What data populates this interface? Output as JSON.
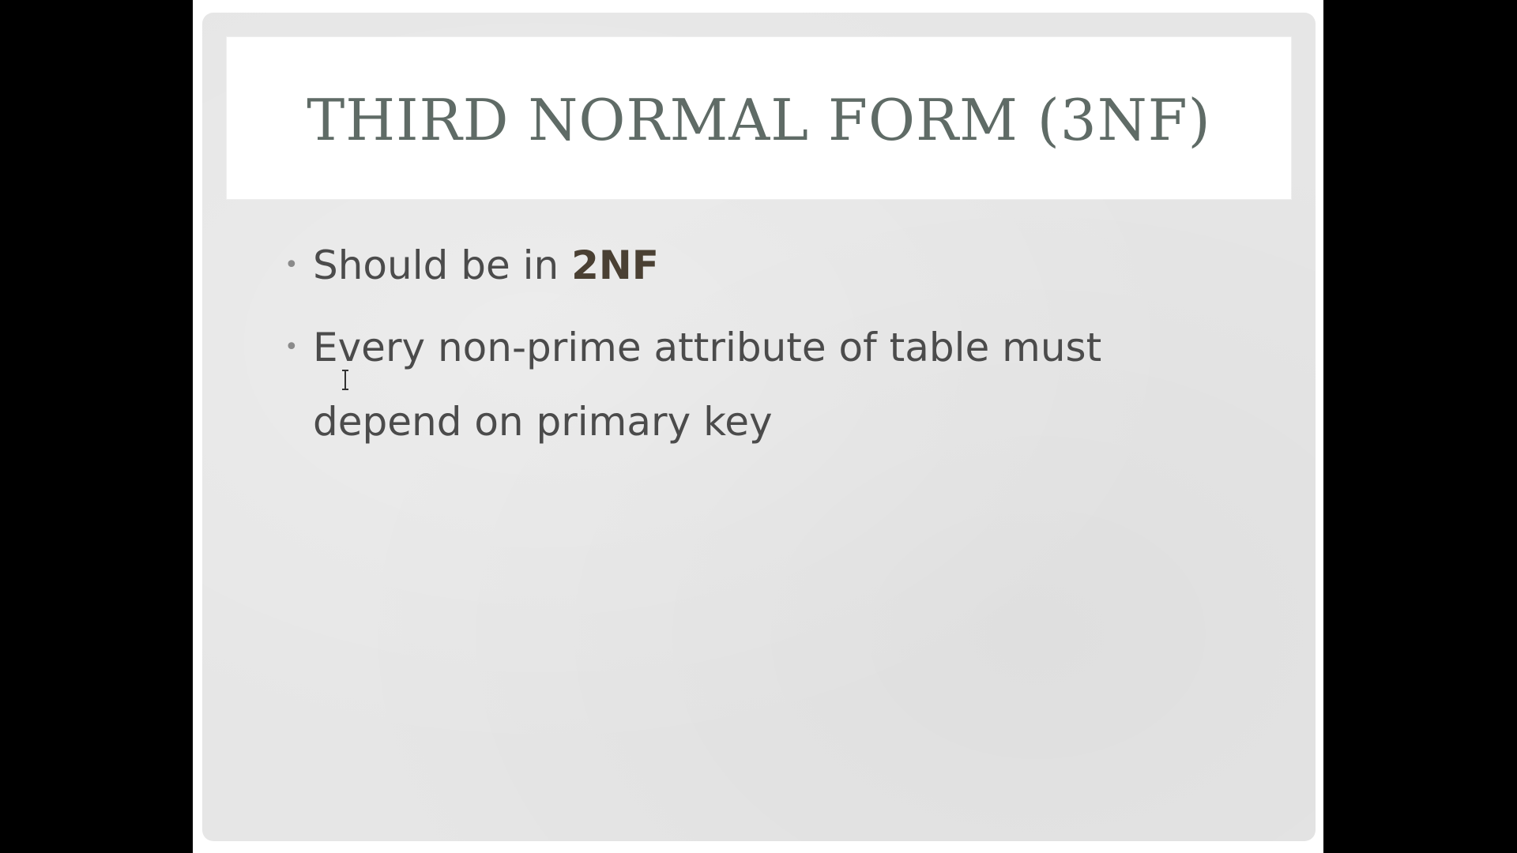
{
  "slide": {
    "title": "THIRD NORMAL FORM (3NF)",
    "bullets": [
      {
        "text": "Should be in ",
        "emphasis": "2NF"
      },
      {
        "text": "Every non-prime attribute of table must depend on primary key",
        "emphasis": ""
      }
    ],
    "bullet_glyph": "•"
  },
  "colors": {
    "background": "#000000",
    "slide_frame": "#ffffff",
    "slide_body": "#e6e6e6",
    "title_box": "#ffffff",
    "title_text": "#5f6b66",
    "body_text": "#4b4b4b",
    "emphasis_text": "#4a4033"
  },
  "icons": {
    "cursor": "text-cursor-icon"
  }
}
